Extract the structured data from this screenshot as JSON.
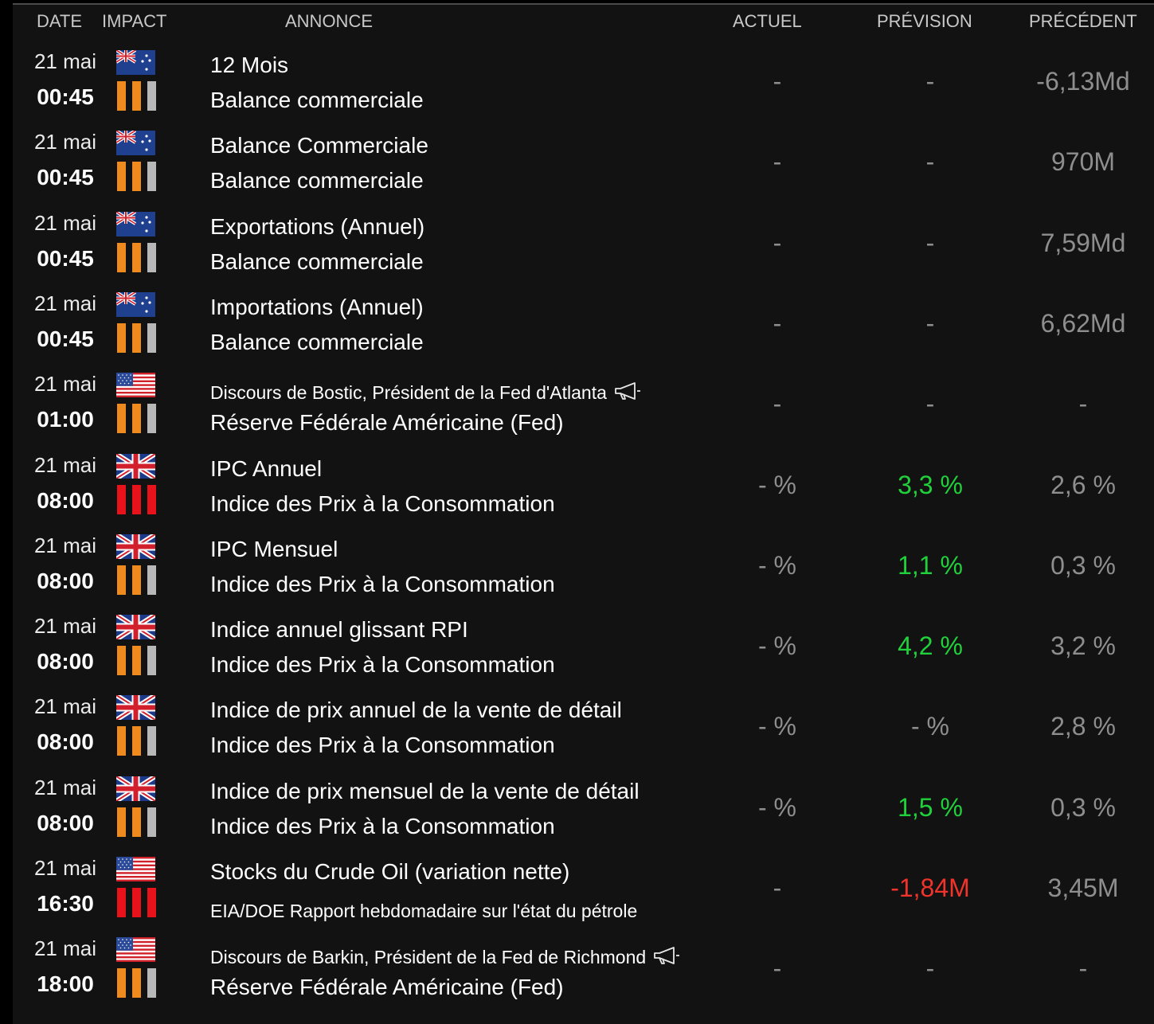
{
  "header": {
    "date": "DATE",
    "impact": "IMPACT",
    "annonce": "ANNONCE",
    "actuel": "ACTUEL",
    "prevision": "PRÉVISION",
    "precedent": "PRÉCÉDENT"
  },
  "colors": {
    "impact_orange": "#ee8a1e",
    "impact_red": "#e8131a",
    "impact_gray": "#b8b8b8",
    "value_gray": "#8e8e8e",
    "value_green": "#21d13b",
    "value_red": "#f0332b"
  },
  "rows": [
    {
      "date": "21 mai",
      "time": "00:45",
      "flag": "nz-flag-icon",
      "impact": [
        "orange",
        "orange",
        "gray"
      ],
      "title": "12 Mois",
      "category": "Balance commerciale",
      "actuel": "-",
      "prevision": "-",
      "precedent": "-6,13Md",
      "prevision_color": "gray"
    },
    {
      "date": "21 mai",
      "time": "00:45",
      "flag": "nz-flag-icon",
      "impact": [
        "orange",
        "orange",
        "gray"
      ],
      "title": "Balance Commerciale",
      "category": "Balance commerciale",
      "actuel": "-",
      "prevision": "-",
      "precedent": "970M",
      "prevision_color": "gray"
    },
    {
      "date": "21 mai",
      "time": "00:45",
      "flag": "nz-flag-icon",
      "impact": [
        "orange",
        "orange",
        "gray"
      ],
      "title": "Exportations (Annuel)",
      "category": "Balance commerciale",
      "actuel": "-",
      "prevision": "-",
      "precedent": "7,59Md",
      "prevision_color": "gray"
    },
    {
      "date": "21 mai",
      "time": "00:45",
      "flag": "nz-flag-icon",
      "impact": [
        "orange",
        "orange",
        "gray"
      ],
      "title": "Importations (Annuel)",
      "category": "Balance commerciale",
      "actuel": "-",
      "prevision": "-",
      "precedent": "6,62Md",
      "prevision_color": "gray"
    },
    {
      "date": "21 mai",
      "time": "01:00",
      "flag": "us-flag-icon",
      "impact": [
        "orange",
        "orange",
        "gray"
      ],
      "title": "Discours de Bostic, Président de la Fed d'Atlanta",
      "category": "Réserve Fédérale Américaine (Fed)",
      "speech": true,
      "actuel": "-",
      "prevision": "-",
      "precedent": "-",
      "prevision_color": "gray"
    },
    {
      "date": "21 mai",
      "time": "08:00",
      "flag": "uk-flag-icon",
      "impact": [
        "red",
        "red",
        "red"
      ],
      "title": "IPC Annuel",
      "category": "Indice des Prix à la Consommation",
      "actuel": "- %",
      "prevision": "3,3 %",
      "precedent": "2,6 %",
      "prevision_color": "green"
    },
    {
      "date": "21 mai",
      "time": "08:00",
      "flag": "uk-flag-icon",
      "impact": [
        "orange",
        "orange",
        "gray"
      ],
      "title": "IPC Mensuel",
      "category": "Indice des Prix à la Consommation",
      "actuel": "- %",
      "prevision": "1,1 %",
      "precedent": "0,3 %",
      "prevision_color": "green"
    },
    {
      "date": "21 mai",
      "time": "08:00",
      "flag": "uk-flag-icon",
      "impact": [
        "orange",
        "orange",
        "gray"
      ],
      "title": "Indice annuel glissant RPI",
      "category": "Indice des Prix à la Consommation",
      "actuel": "- %",
      "prevision": "4,2 %",
      "precedent": "3,2 %",
      "prevision_color": "green"
    },
    {
      "date": "21 mai",
      "time": "08:00",
      "flag": "uk-flag-icon",
      "impact": [
        "orange",
        "orange",
        "gray"
      ],
      "title": "Indice de prix annuel de la vente de détail",
      "category": "Indice des Prix à la Consommation",
      "actuel": "- %",
      "prevision": "- %",
      "precedent": "2,8 %",
      "prevision_color": "gray"
    },
    {
      "date": "21 mai",
      "time": "08:00",
      "flag": "uk-flag-icon",
      "impact": [
        "orange",
        "orange",
        "gray"
      ],
      "title": "Indice de prix mensuel de la vente de détail",
      "category": "Indice des Prix à la Consommation",
      "actuel": "- %",
      "prevision": "1,5 %",
      "precedent": "0,3 %",
      "prevision_color": "green"
    },
    {
      "date": "21 mai",
      "time": "16:30",
      "flag": "us-flag-icon",
      "impact": [
        "red",
        "red",
        "red"
      ],
      "title": "Stocks du Crude Oil (variation nette)",
      "category": "EIA/DOE Rapport hebdomadaire sur l'état du pétrole",
      "small_category": true,
      "actuel": "-",
      "prevision": "-1,84M",
      "precedent": "3,45M",
      "prevision_color": "red"
    },
    {
      "date": "21 mai",
      "time": "18:00",
      "flag": "us-flag-icon",
      "impact": [
        "orange",
        "orange",
        "gray"
      ],
      "title": "Discours de Barkin, Président de la Fed de Richmond",
      "category": "Réserve Fédérale Américaine (Fed)",
      "speech": true,
      "actuel": "-",
      "prevision": "-",
      "precedent": "-",
      "prevision_color": "gray"
    }
  ]
}
